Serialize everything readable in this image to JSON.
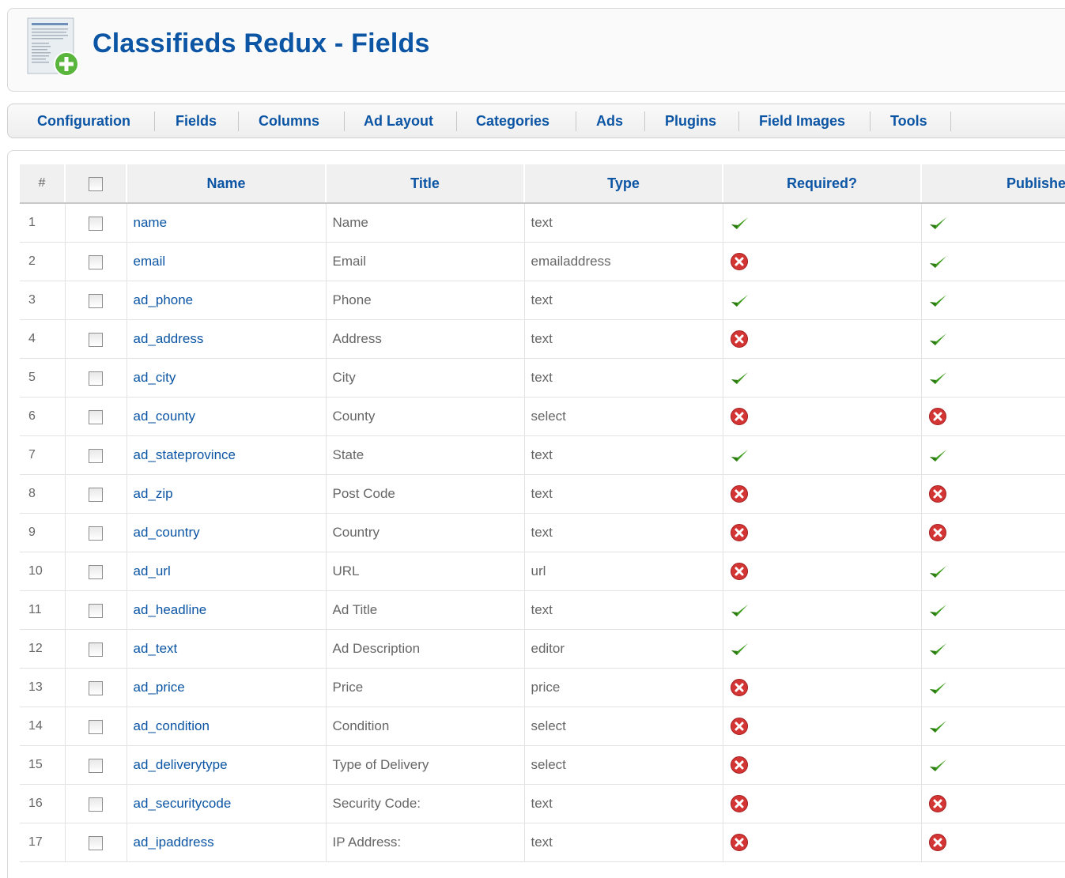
{
  "header": {
    "title": "Classifieds Redux - Fields",
    "logo_icon": "document-add-icon"
  },
  "menu": [
    {
      "label": "Configuration",
      "name": "configuration"
    },
    {
      "label": "Fields",
      "name": "fields"
    },
    {
      "label": "Columns",
      "name": "columns"
    },
    {
      "label": "Ad Layout",
      "name": "ad-layout"
    },
    {
      "label": "Categories",
      "name": "categories"
    },
    {
      "label": "Ads",
      "name": "ads"
    },
    {
      "label": "Plugins",
      "name": "plugins"
    },
    {
      "label": "Field Images",
      "name": "field-images"
    },
    {
      "label": "Tools",
      "name": "tools"
    }
  ],
  "table": {
    "columns": {
      "num": "#",
      "name": "Name",
      "title": "Title",
      "type": "Type",
      "required": "Required?",
      "published": "Published"
    },
    "rows": [
      {
        "num": "1",
        "name": "name",
        "title": "Name",
        "type": "text",
        "required": true,
        "published": true
      },
      {
        "num": "2",
        "name": "email",
        "title": "Email",
        "type": "emailaddress",
        "required": false,
        "published": true
      },
      {
        "num": "3",
        "name": "ad_phone",
        "title": "Phone",
        "type": "text",
        "required": true,
        "published": true
      },
      {
        "num": "4",
        "name": "ad_address",
        "title": "Address",
        "type": "text",
        "required": false,
        "published": true
      },
      {
        "num": "5",
        "name": "ad_city",
        "title": "City",
        "type": "text",
        "required": true,
        "published": true
      },
      {
        "num": "6",
        "name": "ad_county",
        "title": "County",
        "type": "select",
        "required": false,
        "published": false
      },
      {
        "num": "7",
        "name": "ad_stateprovince",
        "title": "State",
        "type": "text",
        "required": true,
        "published": true
      },
      {
        "num": "8",
        "name": "ad_zip",
        "title": "Post Code",
        "type": "text",
        "required": false,
        "published": false
      },
      {
        "num": "9",
        "name": "ad_country",
        "title": "Country",
        "type": "text",
        "required": false,
        "published": false
      },
      {
        "num": "10",
        "name": "ad_url",
        "title": "URL",
        "type": "url",
        "required": false,
        "published": true
      },
      {
        "num": "11",
        "name": "ad_headline",
        "title": "Ad Title",
        "type": "text",
        "required": true,
        "published": true
      },
      {
        "num": "12",
        "name": "ad_text",
        "title": "Ad Description",
        "type": "editor",
        "required": true,
        "published": true
      },
      {
        "num": "13",
        "name": "ad_price",
        "title": "Price",
        "type": "price",
        "required": false,
        "published": true
      },
      {
        "num": "14",
        "name": "ad_condition",
        "title": "Condition",
        "type": "select",
        "required": false,
        "published": true
      },
      {
        "num": "15",
        "name": "ad_deliverytype",
        "title": "Type of Delivery",
        "type": "select",
        "required": false,
        "published": true
      },
      {
        "num": "16",
        "name": "ad_securitycode",
        "title": "Security Code:",
        "type": "text",
        "required": false,
        "published": false
      },
      {
        "num": "17",
        "name": "ad_ipaddress",
        "title": "IP Address:",
        "type": "text",
        "required": false,
        "published": false
      }
    ]
  },
  "icons": {
    "yes": "green-checkmark-icon",
    "no": "red-x-circle-icon"
  },
  "colors": {
    "link": "#0b55a4",
    "check": "#3f9e1f",
    "cross": "#d33434"
  }
}
